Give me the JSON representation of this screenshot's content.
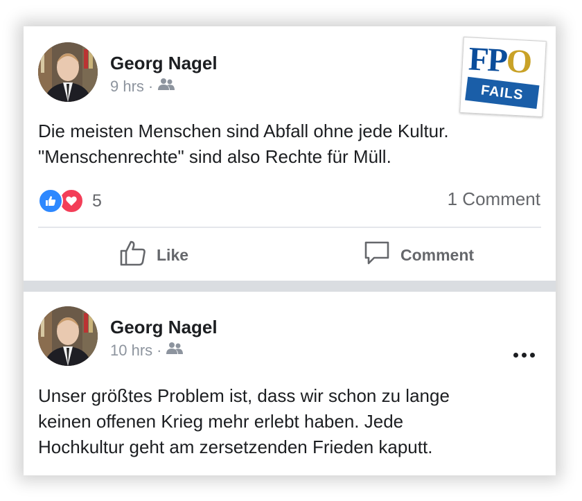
{
  "colors": {
    "like_blue": "#2d88ff",
    "love_red": "#f33e58",
    "muted": "#65676b",
    "separator": "#dadde1",
    "logo_blue": "#0b4d9b",
    "logo_gold": "#c9a227"
  },
  "logo": {
    "fp": "FP",
    "o": "O",
    "band_text": "FAILS"
  },
  "posts": [
    {
      "author": "Georg Nagel",
      "time": "9 hrs",
      "separator": "·",
      "audience_icon": "friends-icon",
      "text_lines": [
        "Die meisten Menschen sind Abfall ohne jede Kultur.",
        "\"Menschenrechte\" sind also Rechte für Müll."
      ],
      "reaction_count": "5",
      "comment_count": "1 Comment",
      "actions": {
        "like": "Like",
        "comment": "Comment"
      }
    },
    {
      "author": "Georg Nagel",
      "time": "10 hrs",
      "separator": "·",
      "audience_icon": "friends-icon",
      "text_lines": [
        "Unser größtes Problem ist, dass wir schon zu lange",
        "keinen offenen Krieg mehr erlebt haben. Jede",
        "Hochkultur geht am zersetzenden Frieden kaputt."
      ]
    }
  ]
}
